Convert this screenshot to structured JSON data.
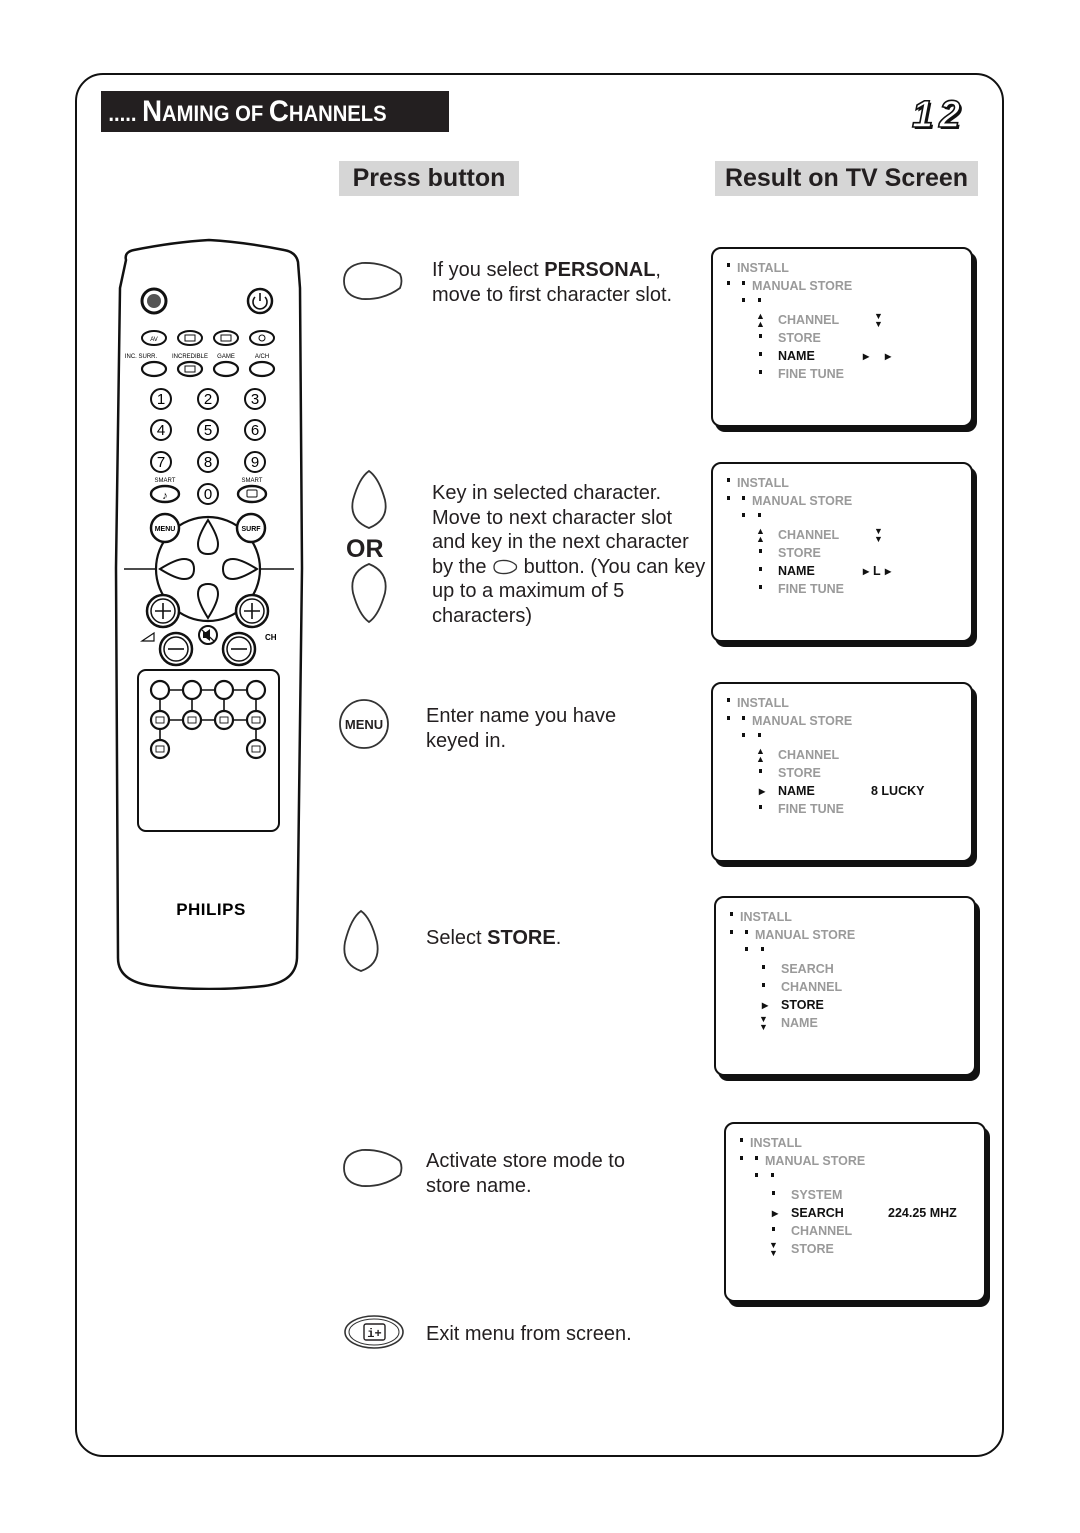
{
  "header": {
    "title_prefix": ".....",
    "title_words": [
      {
        "cap": "N",
        "rest": "AMING"
      },
      {
        "cap": "",
        "rest": "OF"
      },
      {
        "cap": "C",
        "rest": "HANNELS"
      }
    ],
    "page_number": "12"
  },
  "columns": {
    "press": "Press button",
    "result": "Result on TV Screen"
  },
  "remote": {
    "brand": "PHILIPS",
    "labels": {
      "av": "AV",
      "inc_surr": "INC. SURR.",
      "incredible": "INCREDIBLE",
      "game": "GAME",
      "ach": "A/CH",
      "smart_left": "SMART",
      "smart_right": "SMART",
      "menu": "MENU",
      "surf": "SURF",
      "ch": "CH"
    },
    "digits": [
      "1",
      "2",
      "3",
      "4",
      "5",
      "6",
      "7",
      "8",
      "9",
      "0"
    ]
  },
  "steps": [
    {
      "button": "right-button",
      "text_pre": "If you select ",
      "text_bold": "PERSONAL",
      "text_post": ", move to first character slot."
    },
    {
      "button": "up-or-down-button",
      "or_label": "OR",
      "text_a": "Key in selected character. Move to next character slot and key in the next character by the ",
      "text_b": " button. (You can key up to a maximum of 5 characters)"
    },
    {
      "button": "menu-button",
      "button_label": "MENU",
      "text": "Enter name you have keyed in."
    },
    {
      "button": "up-button",
      "text_pre": "Select ",
      "text_bold": "STORE",
      "text_post": "."
    },
    {
      "button": "right-button",
      "text": "Activate store mode to store name."
    },
    {
      "button": "info-exit-button",
      "button_label": "i+",
      "text": "Exit menu from screen."
    }
  ],
  "tv_screens": [
    {
      "install": "INSTALL",
      "manual_store": "MANUAL STORE",
      "items": [
        {
          "label": "CHANNEL",
          "marker": "up-down",
          "active": false
        },
        {
          "label": "STORE",
          "marker": "square",
          "active": false
        },
        {
          "label": "NAME",
          "marker": "square",
          "active": true
        },
        {
          "label": "FINE TUNE",
          "marker": "square",
          "active": false
        }
      ],
      "channel_side_marker": "down-arrows",
      "name_value": "",
      "name_cursor": "two-cursors"
    },
    {
      "install": "INSTALL",
      "manual_store": "MANUAL STORE",
      "items": [
        {
          "label": "CHANNEL",
          "marker": "up-down",
          "active": false
        },
        {
          "label": "STORE",
          "marker": "square",
          "active": false
        },
        {
          "label": "NAME",
          "marker": "square",
          "active": true
        },
        {
          "label": "FINE TUNE",
          "marker": "square",
          "active": false
        }
      ],
      "channel_side_marker": "down-arrows",
      "name_value": "L",
      "name_cursor": "cursor-L-cursor"
    },
    {
      "install": "INSTALL",
      "manual_store": "MANUAL STORE",
      "items": [
        {
          "label": "CHANNEL",
          "marker": "up-arrows",
          "active": false
        },
        {
          "label": "STORE",
          "marker": "square",
          "active": false
        },
        {
          "label": "NAME",
          "marker": "pointer",
          "active": true
        },
        {
          "label": "FINE TUNE",
          "marker": "square",
          "active": false
        }
      ],
      "name_value": "8 LUCKY"
    },
    {
      "install": "INSTALL",
      "manual_store": "MANUAL STORE",
      "items": [
        {
          "label": "SEARCH",
          "marker": "square",
          "active": false
        },
        {
          "label": "CHANNEL",
          "marker": "square",
          "active": false
        },
        {
          "label": "STORE",
          "marker": "pointer",
          "active": true
        },
        {
          "label": "NAME",
          "marker": "down-arrows",
          "active": false
        }
      ]
    },
    {
      "install": "INSTALL",
      "manual_store": "MANUAL STORE",
      "items": [
        {
          "label": "SYSTEM",
          "marker": "square",
          "active": false
        },
        {
          "label": "SEARCH",
          "marker": "pointer",
          "active": true
        },
        {
          "label": "CHANNEL",
          "marker": "square",
          "active": false
        },
        {
          "label": "STORE",
          "marker": "down-arrows",
          "active": false
        }
      ],
      "search_value": "224.25 MHZ"
    }
  ]
}
